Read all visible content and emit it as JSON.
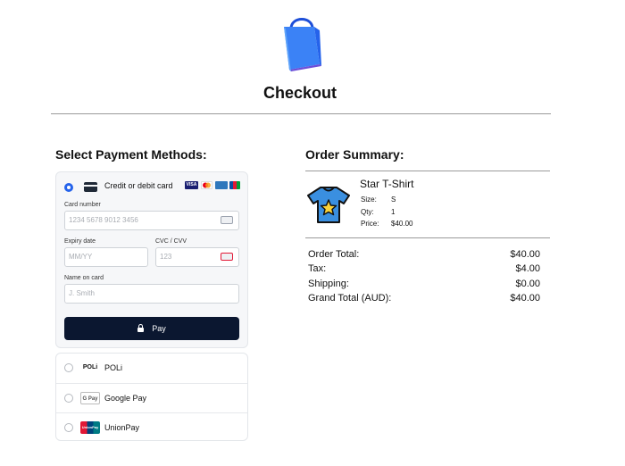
{
  "header": {
    "title": "Checkout",
    "logo_icon": "shopping-bag-icon"
  },
  "payment": {
    "section_title": "Select Payment Methods:",
    "card_method": {
      "label": "Credit or debit card",
      "selected": true,
      "brands": [
        "VISA",
        "Mastercard",
        "AMEX",
        "JCB"
      ]
    },
    "card_number": {
      "label": "Card number",
      "placeholder": "1234 5678 9012 3456"
    },
    "expiry": {
      "label": "Expiry date",
      "placeholder": "MM/YY"
    },
    "cvc": {
      "label": "CVC / CVV",
      "placeholder": "123"
    },
    "name": {
      "label": "Name on card",
      "placeholder": "J. Smith"
    },
    "pay_button": "Pay",
    "other_methods": [
      {
        "label": "POLi",
        "logo_text": "POLi"
      },
      {
        "label": "Google Pay",
        "logo_text": "G Pay"
      },
      {
        "label": "UnionPay",
        "logo_text": "UnionPay"
      }
    ]
  },
  "summary": {
    "section_title": "Order Summary:",
    "item": {
      "name": "Star T-Shirt",
      "icon": "tshirt-star-icon",
      "size_label": "Size:",
      "size": "S",
      "qty_label": "Qty:",
      "qty": "1",
      "price_label": "Price:",
      "price": "$40.00"
    },
    "totals": [
      {
        "label": "Order Total:",
        "value": "$40.00"
      },
      {
        "label": "Tax:",
        "value": "$4.00"
      },
      {
        "label": "Shipping:",
        "value": "$0.00"
      },
      {
        "label": "Grand Total (AUD):",
        "value": "$40.00"
      }
    ]
  },
  "colors": {
    "accent": "#2563eb",
    "pay_button": "#0b1730",
    "bag": "#3b82f6"
  }
}
